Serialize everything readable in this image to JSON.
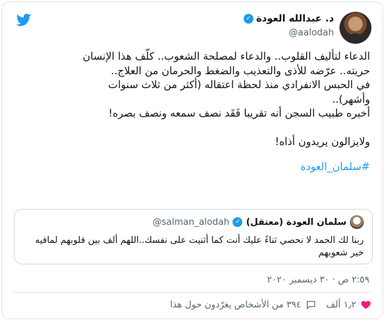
{
  "tweet": {
    "display_name": "د. عبدالله العودة",
    "handle": "@aalodah",
    "verified_icon": "verified-icon",
    "lines": [
      "الدعاء لتأليف القلوب.. والدعاء لمصلحة الشعوب.. كلّف هذا الإنسان",
      "حريته.. عرّضه للأذى والتعذيب والضغط والحرمان من العلاج..",
      "في الحبس الانفرادي منذ لحظة اعتقاله (أكثر من ثلاث سنوات",
      "وأشهر)..",
      "أخبره طبيب السجن أنه تقريبا فَقَد نصف سمعه ونصف بصره!",
      "",
      "ولايزالون يريدون أذاه!"
    ],
    "hashtag": "#سلمان_العودة",
    "date": "٢:٥٩ ص · ٣٠ ديسمبر ٢٠٢٠",
    "likes": "١٫٢ ألف",
    "people_talking": "٣٩٤ من الأشخاص يغرّدون حول هذا"
  },
  "quote": {
    "display_name": "سلمان العودة (معتقل)",
    "handle": "@salman_alodah",
    "text": "ربنا لك الحمد لا نحصي ثناءً عليك أنت كما أثنيت على نفسك..اللهم ألف بين قلوبهم لمافيه خير شعوبهم"
  },
  "icons": {
    "brand": "twitter-bird-icon",
    "heart": "heart-icon",
    "reply": "reply-icon",
    "quote_avatar": "avatar"
  },
  "colors": {
    "accent": "#1d9bf0",
    "text": "#0f1419",
    "muted": "#536471",
    "border": "#dfe3e6",
    "heart": "#f91880"
  }
}
